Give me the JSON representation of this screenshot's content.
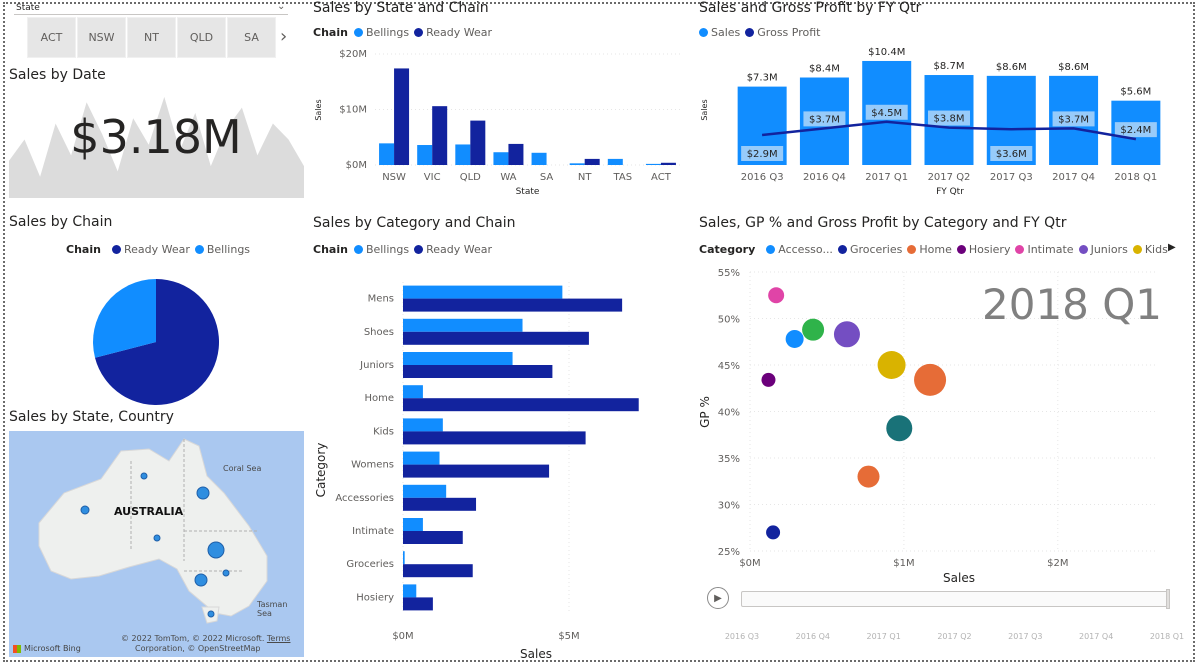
{
  "slicer": {
    "label": "State",
    "options": [
      "ACT",
      "NSW",
      "NT",
      "QLD",
      "SA"
    ]
  },
  "sales_by_date": {
    "title": "Sales by Date",
    "value": "$3.18M"
  },
  "sales_by_chain": {
    "title": "Sales by Chain",
    "legend_label": "Chain",
    "legend": [
      "Ready Wear",
      "Bellings"
    ]
  },
  "sales_by_state_country": {
    "title": "Sales by State, Country",
    "country_label": "AUSTRALIA",
    "coral_sea": "Coral Sea",
    "tasman_sea": "Tasman Sea",
    "attribution_1": "© 2022 TomTom, © 2022 Microsoft",
    "attribution_terms": "Terms",
    "attribution_2": "Corporation, © OpenStreetMap",
    "bing": "Microsoft Bing"
  },
  "state_chain": {
    "title": "Sales by State and Chain",
    "legend_label": "Chain"
  },
  "category_chain": {
    "title": "Sales by Category and Chain",
    "legend_label": "Chain"
  },
  "sales_gp_qtr": {
    "title": "Sales and Gross Profit by FY Qtr"
  },
  "scatter": {
    "title": "Sales, GP % and Gross Profit by Category and FY Qtr",
    "legend_label": "Category",
    "frame_label": "2018 Q1",
    "play_axis": [
      "2016 Q3",
      "2016 Q4",
      "2017 Q1",
      "2017 Q2",
      "2017 Q3",
      "2017 Q4",
      "2018 Q1"
    ]
  },
  "colors": {
    "bellings": "#118dff",
    "ready_wear": "#12239e",
    "light_bar": "#a6d1fa",
    "map_water": "#aac8f0",
    "map_land": "#eef0ee"
  },
  "chart_data": [
    {
      "type": "area",
      "title": "Sales by Date",
      "note_value": "$3.18M",
      "y": [
        0.35,
        0.55,
        0.2,
        0.7,
        0.4,
        0.9,
        0.6,
        0.25,
        0.75,
        0.5,
        0.95,
        0.45,
        0.8,
        0.3,
        0.65,
        0.85,
        0.4,
        0.7,
        0.55,
        0.3
      ]
    },
    {
      "type": "pie",
      "title": "Sales by Chain",
      "categories": [
        "Ready Wear",
        "Bellings"
      ],
      "values": [
        71,
        29
      ]
    },
    {
      "type": "bar",
      "title": "Sales by State and Chain",
      "xlabel": "State",
      "ylabel": "Sales",
      "ylim": [
        0,
        20
      ],
      "yticks": [
        "$0M",
        "$10M",
        "$20M"
      ],
      "categories": [
        "NSW",
        "VIC",
        "QLD",
        "WA",
        "SA",
        "NT",
        "TAS",
        "ACT"
      ],
      "series": [
        {
          "name": "Bellings",
          "values": [
            3.9,
            3.6,
            3.7,
            2.3,
            2.2,
            0.3,
            1.1,
            0.2
          ]
        },
        {
          "name": "Ready Wear",
          "values": [
            17.4,
            10.6,
            8.0,
            3.8,
            0,
            1.1,
            0,
            0.4
          ]
        }
      ]
    },
    {
      "type": "bar",
      "title": "Sales and Gross Profit by FY Qtr",
      "xlabel": "FY Qtr",
      "ylabel": "Sales",
      "categories": [
        "2016 Q3",
        "2016 Q4",
        "2017 Q1",
        "2017 Q2",
        "2017 Q3",
        "2017 Q4",
        "2018 Q1"
      ],
      "series": [
        {
          "name": "Sales",
          "values": [
            7.3,
            8.4,
            10.4,
            8.7,
            8.6,
            8.6,
            5.6
          ],
          "labels": [
            "$7.3M",
            "$8.4M",
            "$10.4M",
            "$8.7M",
            "$8.6M",
            "$8.6M",
            "$5.6M"
          ]
        },
        {
          "name": "Gross Profit",
          "values": [
            2.9,
            3.7,
            4.5,
            3.8,
            3.6,
            3.7,
            2.4
          ],
          "labels": [
            "$2.9M",
            "$3.7M",
            "$4.5M",
            "$3.8M",
            "$3.6M",
            "$3.7M",
            "$2.4M"
          ]
        }
      ]
    },
    {
      "type": "bar",
      "title": "Sales by Category and Chain",
      "xlabel": "Sales",
      "ylabel": "Category",
      "xlim": [
        0,
        7
      ],
      "xticks": [
        "$0M",
        "$5M"
      ],
      "categories": [
        "Mens",
        "Shoes",
        "Juniors",
        "Home",
        "Kids",
        "Womens",
        "Accessories",
        "Intimate",
        "Groceries",
        "Hosiery"
      ],
      "series": [
        {
          "name": "Bellings",
          "values": [
            4.8,
            3.6,
            3.3,
            0.6,
            1.2,
            1.1,
            1.3,
            0.6,
            0.05,
            0.4
          ]
        },
        {
          "name": "Ready Wear",
          "values": [
            6.6,
            5.6,
            4.5,
            7.1,
            5.5,
            4.4,
            2.2,
            1.8,
            2.1,
            0.9
          ]
        }
      ]
    },
    {
      "type": "scatter",
      "title": "Sales, GP % and Gross Profit by Category and FY Qtr",
      "xlabel": "Sales",
      "ylabel": "GP %",
      "xlim": [
        0,
        2.5
      ],
      "ylim": [
        25,
        55
      ],
      "xticks": [
        "$0M",
        "$1M",
        "$2M"
      ],
      "yticks": [
        "25%",
        "30%",
        "35%",
        "40%",
        "45%",
        "50%",
        "55%"
      ],
      "legend": [
        "Accesso...",
        "Groceries",
        "Home",
        "Hosiery",
        "Intimate",
        "Juniors",
        "Kids"
      ],
      "points": [
        {
          "name": "Intimate",
          "x": 0.17,
          "y": 52.5,
          "size": 8,
          "color": "#e044a7"
        },
        {
          "name": "Accessories",
          "x": 0.29,
          "y": 47.8,
          "size": 9,
          "color": "#118dff"
        },
        {
          "name": "Shoes",
          "x": 0.41,
          "y": 48.8,
          "size": 11,
          "color": "#2fb34a"
        },
        {
          "name": "Juniors",
          "x": 0.63,
          "y": 48.3,
          "size": 13,
          "color": "#744ec2"
        },
        {
          "name": "Hosiery",
          "x": 0.12,
          "y": 43.4,
          "size": 7,
          "color": "#6b007b"
        },
        {
          "name": "Kids",
          "x": 0.92,
          "y": 45.0,
          "size": 14,
          "color": "#d9b300"
        },
        {
          "name": "Home",
          "x": 1.17,
          "y": 43.4,
          "size": 16,
          "color": "#e66c37"
        },
        {
          "name": "Mens",
          "x": 0.97,
          "y": 38.2,
          "size": 13,
          "color": "#197278"
        },
        {
          "name": "Womens",
          "x": 0.77,
          "y": 33.0,
          "size": 11,
          "color": "#e66c37"
        },
        {
          "name": "Groceries",
          "x": 0.15,
          "y": 27.0,
          "size": 7,
          "color": "#12239e"
        }
      ]
    }
  ]
}
